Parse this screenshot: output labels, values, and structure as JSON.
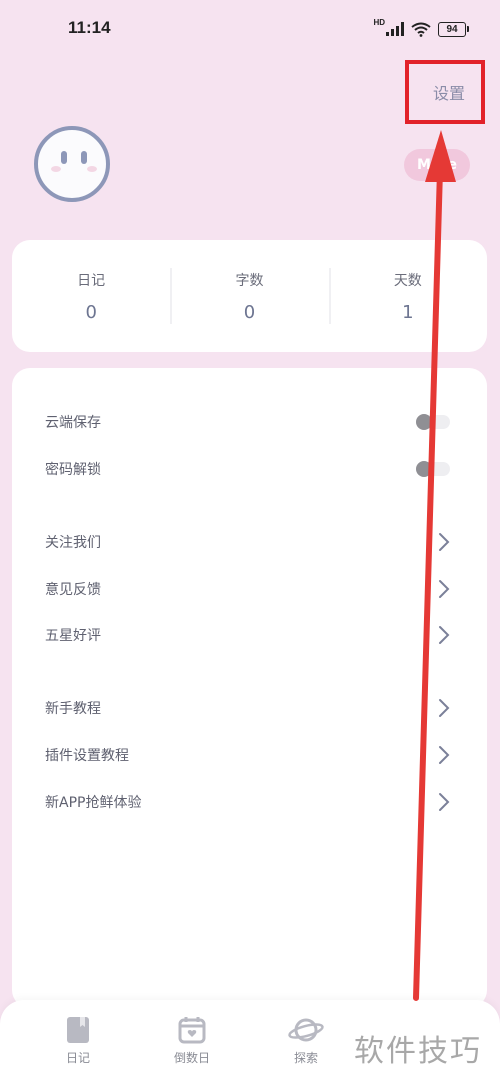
{
  "status_bar": {
    "time": "11:14",
    "hd_label": "HD",
    "battery_level": "94"
  },
  "header": {
    "settings_label": "设置",
    "more_label": "More"
  },
  "stats": [
    {
      "label": "日记",
      "value": "0"
    },
    {
      "label": "字数",
      "value": "0"
    },
    {
      "label": "天数",
      "value": "1"
    }
  ],
  "menu": {
    "toggles": [
      {
        "label": "云端保存",
        "on": false
      },
      {
        "label": "密码解锁",
        "on": false
      }
    ],
    "group2": [
      {
        "label": "关注我们"
      },
      {
        "label": "意见反馈"
      },
      {
        "label": "五星好评"
      }
    ],
    "group3": [
      {
        "label": "新手教程"
      },
      {
        "label": "插件设置教程"
      },
      {
        "label": "新APP抢鲜体验"
      }
    ]
  },
  "bottom_nav": [
    {
      "label": "日记",
      "icon": "diary-icon"
    },
    {
      "label": "倒数日",
      "icon": "calendar-icon"
    },
    {
      "label": "探索",
      "icon": "planet-icon"
    }
  ],
  "watermark": "软件技巧",
  "colors": {
    "background": "#f6e3f0",
    "highlight_box": "#e2222a",
    "annotation_arrow": "#e53935",
    "accent": "#8d97b8",
    "more_button": "#f1c8dd"
  }
}
